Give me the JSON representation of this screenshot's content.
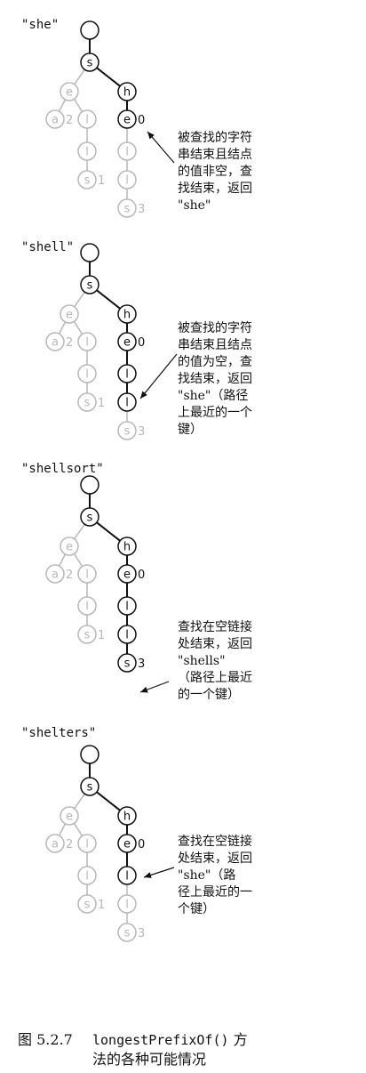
{
  "panels": [
    {
      "query": "\"she\"",
      "note_lines": [
        "被查找的字符",
        "串结束且结点",
        "的值非空，查",
        "找结束，返回",
        "\"she\""
      ],
      "path_len": 3,
      "value_labels": {
        "e": "0",
        "s1": "1",
        "s3": "3",
        "a": "2"
      }
    },
    {
      "query": "\"shell\"",
      "note_lines": [
        "被查找的字符",
        "串结束且结点",
        "的值为空，查",
        "找结束，返回",
        "\"she\"（路径",
        "上最近的一个",
        "键）"
      ],
      "path_len": 5,
      "value_labels": {
        "e": "0",
        "s1": "1",
        "s3": "3",
        "a": "2"
      }
    },
    {
      "query": "\"shellsort\"",
      "note_lines": [
        "查找在空链接",
        "处结束，返回",
        "\"shells\"",
        "（路径上最近",
        "的一个键）"
      ],
      "path_len": 6,
      "value_labels": {
        "e": "0",
        "s1": "1",
        "s3": "3",
        "a": "2"
      }
    },
    {
      "query": "\"shelters\"",
      "note_lines": [
        "查找在空链接",
        "处结束，返回",
        "\"she\"（路",
        "径上最近的一",
        "个键）"
      ],
      "path_len": 4,
      "value_labels": {
        "e": "0",
        "s1": "1",
        "s3": "3",
        "a": "2"
      }
    }
  ],
  "caption": {
    "label": "图 5.2.7",
    "method": "longestPrefixOf()",
    "line1_rest": " 方",
    "line2": "法的各种可能情况"
  }
}
